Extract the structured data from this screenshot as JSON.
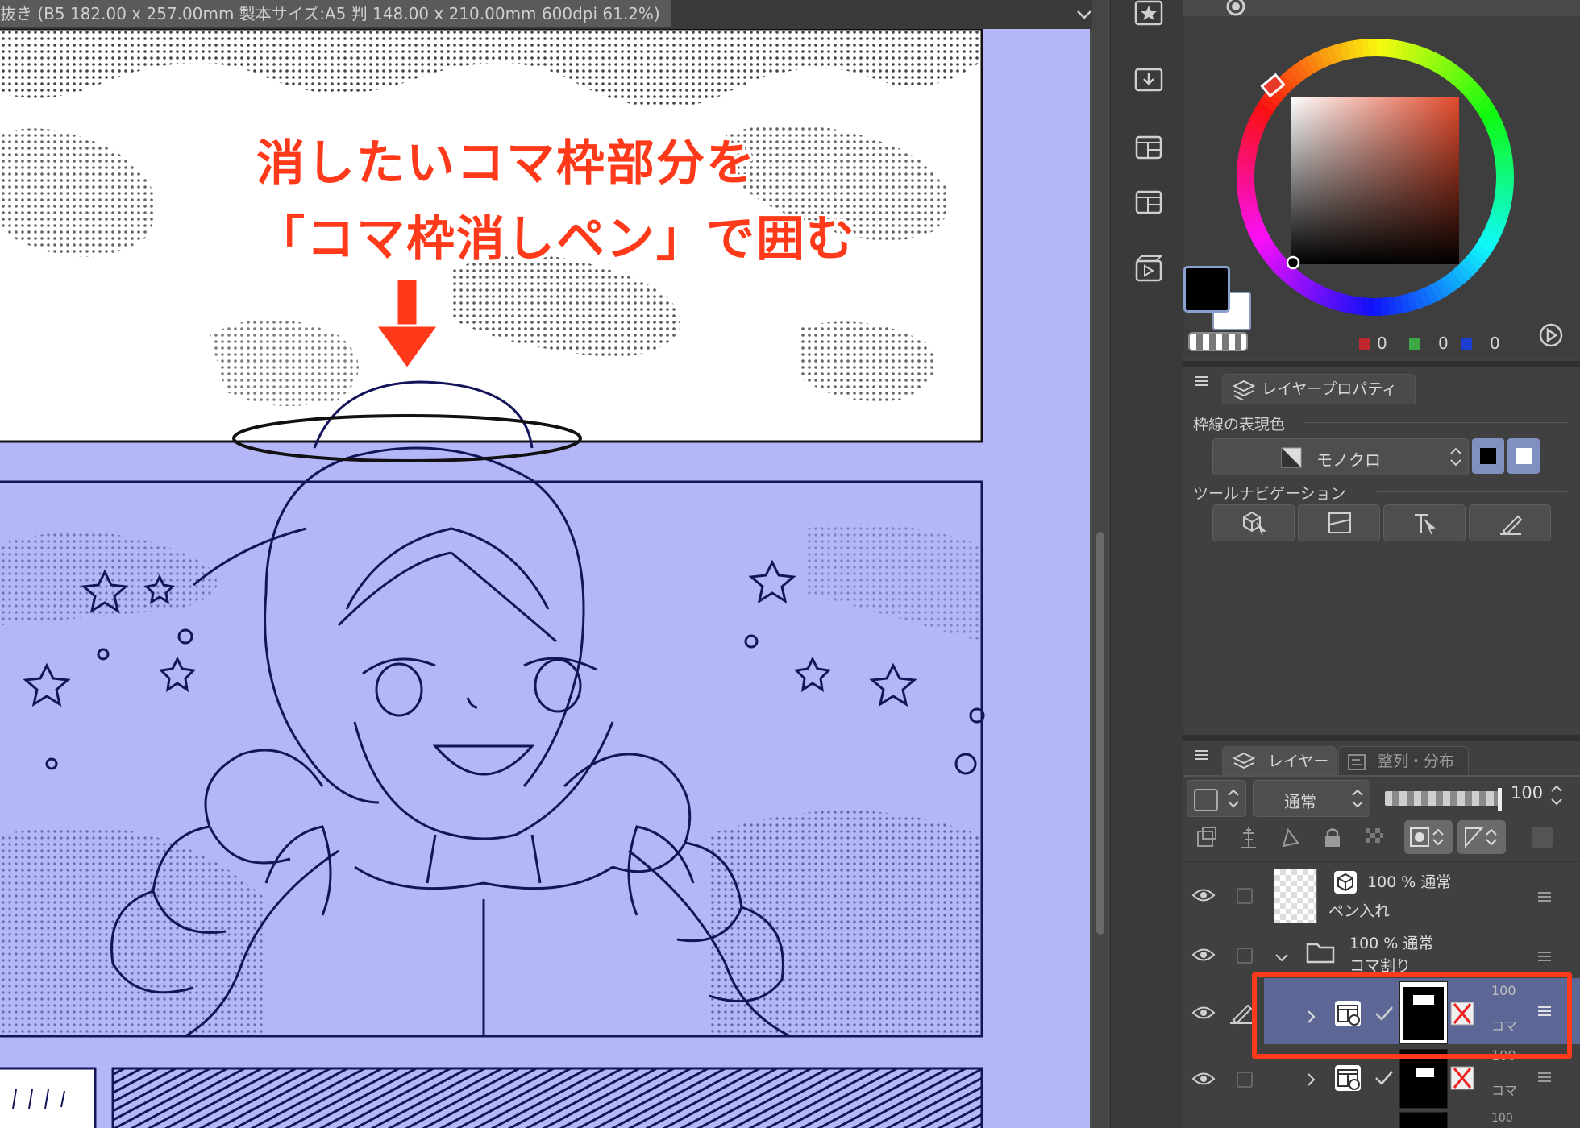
{
  "window": {
    "title": "抜き (B5 182.00 x 257.00mm 製本サイズ:A5 判 148.00 x 210.00mm 600dpi 61.2%)"
  },
  "annotation": {
    "line1": "消したいコマ枠部分を",
    "line2": "「コマ枠消しペン」で囲む"
  },
  "icon_strip": [
    {
      "icon": "star-favorite-icon"
    },
    {
      "icon": "download-material-icon"
    },
    {
      "icon": "frame-template-icon"
    },
    {
      "icon": "frame-template-icon"
    },
    {
      "icon": "timeline-animation-icon"
    }
  ],
  "color_panel": {
    "rgb_values": {
      "r": "0",
      "g": "0",
      "b": "0"
    },
    "main_color": "#000000",
    "sub_color": "#ffffff"
  },
  "layer_property": {
    "tab_label": "レイヤープロパティ",
    "border_color_label": "枠線の表現色",
    "border_color_value": "モノクロ",
    "tool_nav_label": "ツールナビゲーション"
  },
  "layer_panel": {
    "tabs": [
      "レイヤー",
      "整列・分布"
    ],
    "blend_mode": "通常",
    "opacity": "100",
    "layers": [
      {
        "percent": "100 %",
        "mode": "通常",
        "name": "ペン入れ"
      },
      {
        "percent": "100 %",
        "mode": "通常",
        "name": "コマ割り"
      },
      {
        "percent": "100",
        "name": "コマ",
        "selected": true
      },
      {
        "percent": "100",
        "name": "コマ"
      },
      {
        "percent": "100",
        "name": ""
      }
    ]
  },
  "colors": {
    "accent": "#ff3a1a",
    "highlight_box": "#ff3a1a",
    "layer_color": "#b4b6f7",
    "ink": "#14145a"
  }
}
